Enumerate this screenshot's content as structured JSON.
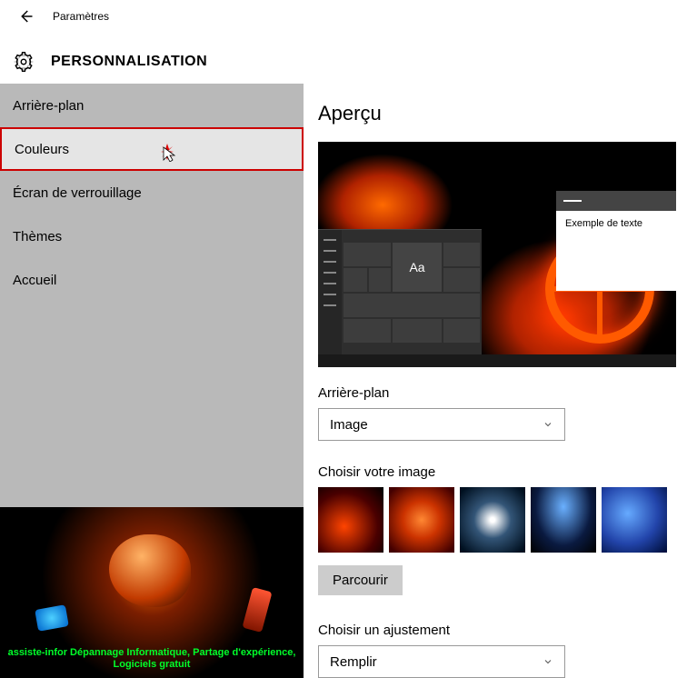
{
  "header": {
    "title": "Paramètres"
  },
  "section": {
    "title": "PERSONNALISATION"
  },
  "sidebar": {
    "items": [
      {
        "label": "Arrière-plan"
      },
      {
        "label": "Couleurs"
      },
      {
        "label": "Écran de verrouillage"
      },
      {
        "label": "Thèmes"
      },
      {
        "label": "Accueil"
      }
    ],
    "promo_text": "assiste-infor Dépannage Informatique, Partage d'expérience, Logiciels gratuit"
  },
  "panel": {
    "preview_heading": "Aperçu",
    "preview_window_text": "Exemple de texte",
    "preview_aa": "Aa",
    "background_label": "Arrière-plan",
    "background_value": "Image",
    "choose_image_label": "Choisir votre image",
    "browse_label": "Parcourir",
    "fit_label": "Choisir un ajustement",
    "fit_value": "Remplir"
  }
}
